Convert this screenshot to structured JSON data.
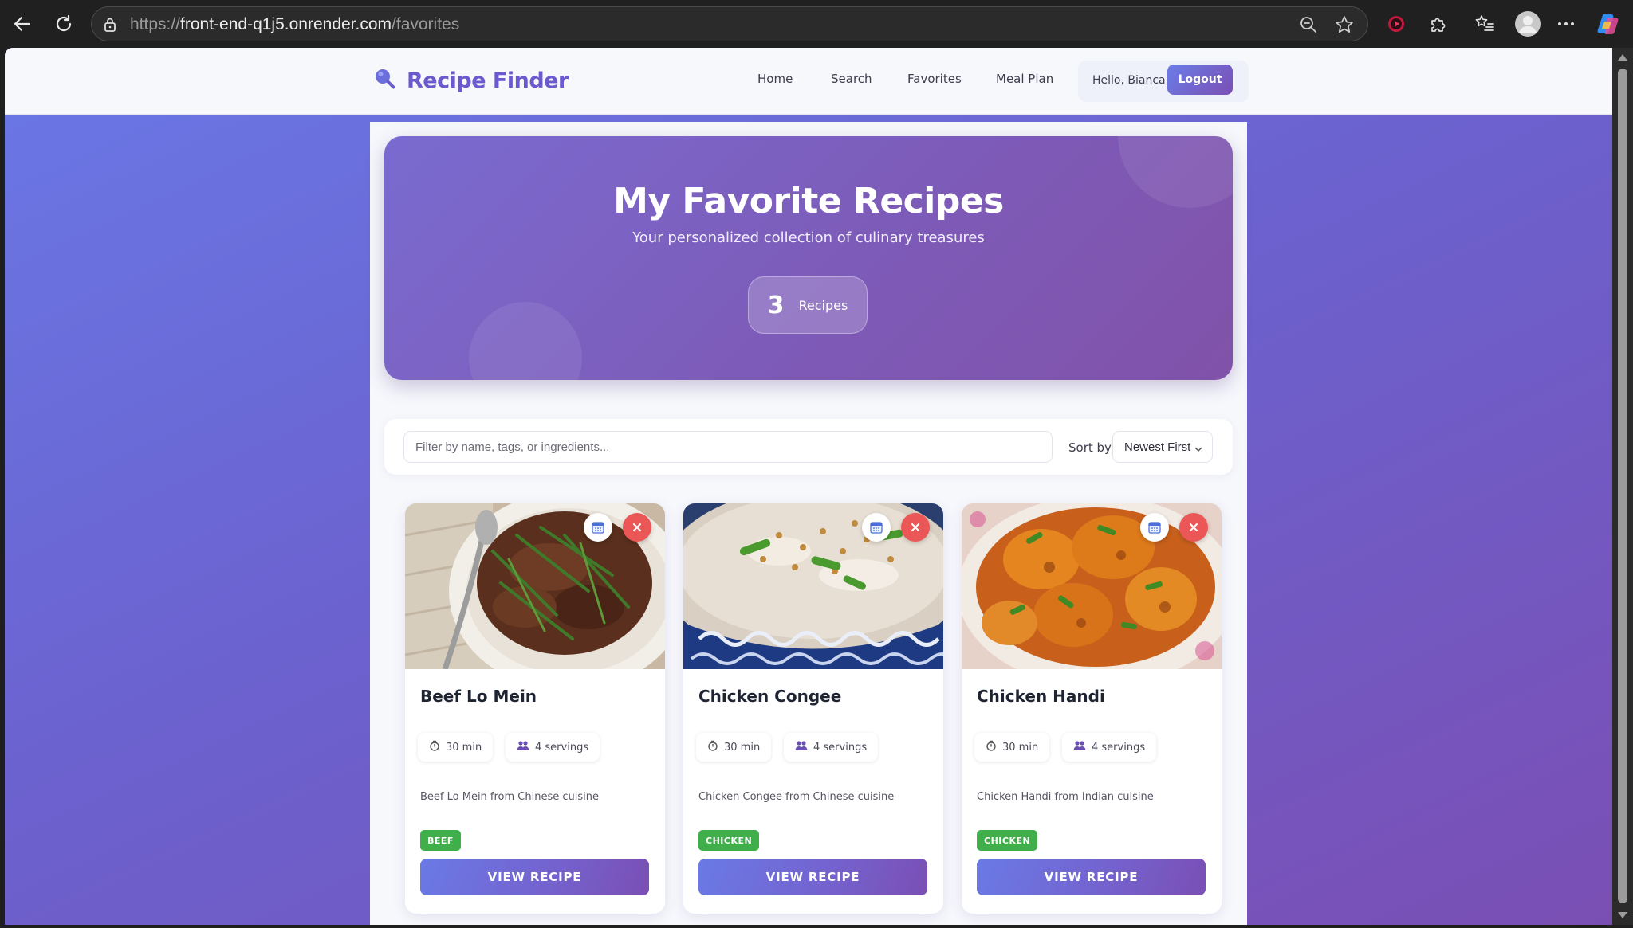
{
  "browser": {
    "url_prefix": "https://",
    "url_host": "front-end-q1j5.onrender.com",
    "url_path": "/favorites"
  },
  "header": {
    "brand": "Recipe Finder",
    "nav": [
      "Home",
      "Search",
      "Favorites",
      "Meal Plan"
    ],
    "greeting": "Hello, Bianca",
    "logout_label": "Logout"
  },
  "hero": {
    "title": "My Favorite Recipes",
    "subtitle": "Your personalized collection of culinary treasures",
    "count": "3",
    "count_label": "Recipes"
  },
  "filter": {
    "placeholder": "Filter by name, tags, or ingredients...",
    "sort_label": "Sort by:",
    "sort_value": "Newest First"
  },
  "recipes": [
    {
      "name": "Beef Lo Mein",
      "time": "30 min",
      "servings": "4 servings",
      "description": "Beef Lo Mein from Chinese cuisine",
      "tag": "BEEF",
      "button": "VIEW RECIPE"
    },
    {
      "name": "Chicken Congee",
      "time": "30 min",
      "servings": "4 servings",
      "description": "Chicken Congee from Chinese cuisine",
      "tag": "CHICKEN",
      "button": "VIEW RECIPE"
    },
    {
      "name": "Chicken Handi",
      "time": "30 min",
      "servings": "4 servings",
      "description": "Chicken Handi from Indian cuisine",
      "tag": "CHICKEN",
      "button": "VIEW RECIPE"
    }
  ],
  "colors": {
    "brand": "#6a5acd",
    "gradient_start": "#6a7ae6",
    "gradient_end": "#7a4fb4",
    "remove_button": "#eb5757",
    "tag_green": "#3fae4b"
  },
  "icons": {
    "back": "back-arrow-icon",
    "refresh": "refresh-icon",
    "lock": "lock-icon",
    "brand": "search-icon",
    "calendar": "calendar-icon",
    "remove": "close-icon",
    "time": "stopwatch-icon",
    "servings": "people-icon"
  }
}
